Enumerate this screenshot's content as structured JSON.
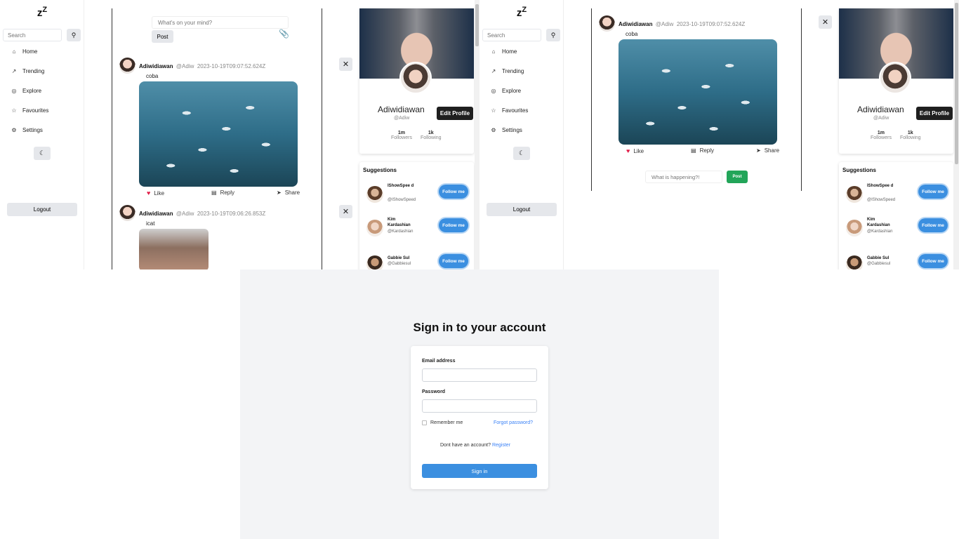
{
  "app": {
    "logo": "z",
    "logo_sup": "Z"
  },
  "sidebar": {
    "search_placeholder": "Search",
    "items": [
      {
        "label": "Home",
        "icon": "home-icon",
        "glyph": "⌂"
      },
      {
        "label": "Trending",
        "icon": "trending-icon",
        "glyph": "↗"
      },
      {
        "label": "Explore",
        "icon": "explore-icon",
        "glyph": "◎"
      },
      {
        "label": "Favourites",
        "icon": "star-icon",
        "glyph": "☆"
      },
      {
        "label": "Settings",
        "icon": "gear-icon",
        "glyph": "⚙"
      }
    ],
    "theme_glyph": "☾",
    "logout_label": "Logout"
  },
  "feed": {
    "composer_placeholder": "What's on your mind?",
    "post_label": "Post",
    "posts": [
      {
        "name": "Adiwidiawan",
        "handle": "@Adiw",
        "time": "2023-10-19T09:07:52.624Z",
        "text": "coba"
      },
      {
        "name": "Adiwidiawan",
        "handle": "@Adiw",
        "time": "2023-10-19T09:06:26.853Z",
        "text": "icat"
      }
    ],
    "actions": {
      "like": "Like",
      "reply": "Reply",
      "share": "Share"
    }
  },
  "profile": {
    "name": "Adiwidiawan",
    "handle": "@Adiw",
    "edit_label": "Edit Profile",
    "followers_count": "1m",
    "followers_label": "Followers",
    "following_count": "1k",
    "following_label": "Following"
  },
  "suggestions": {
    "title": "Suggestions",
    "follow_label": "Follow me",
    "people": [
      {
        "name": "IShowSpee d",
        "handle": "@IShowSpeed"
      },
      {
        "name": "Kim Kardashian",
        "handle": "@Kardashian"
      },
      {
        "name": "Gabbie Sul",
        "handle": "@Gabbiesul"
      }
    ]
  },
  "detail": {
    "name": "Adiwidiawan",
    "handle": "@Adiw",
    "time": "2023-10-19T09:07:52.624Z",
    "text": "coba",
    "reply_placeholder": "What is happening?!",
    "reply_post_label": "Post"
  },
  "close_glyph": "✕",
  "login": {
    "title": "Sign in to your account",
    "email_label": "Email address",
    "password_label": "Password",
    "remember_label": "Remember me",
    "forgot_label": "Forgot password?",
    "no_account_text": "Dont have an account?",
    "register_label": "Register",
    "signin_label": "Sign in"
  },
  "colors": {
    "accent": "#3b8fe0",
    "post_green": "#22a559",
    "like_red": "#e11d48"
  }
}
